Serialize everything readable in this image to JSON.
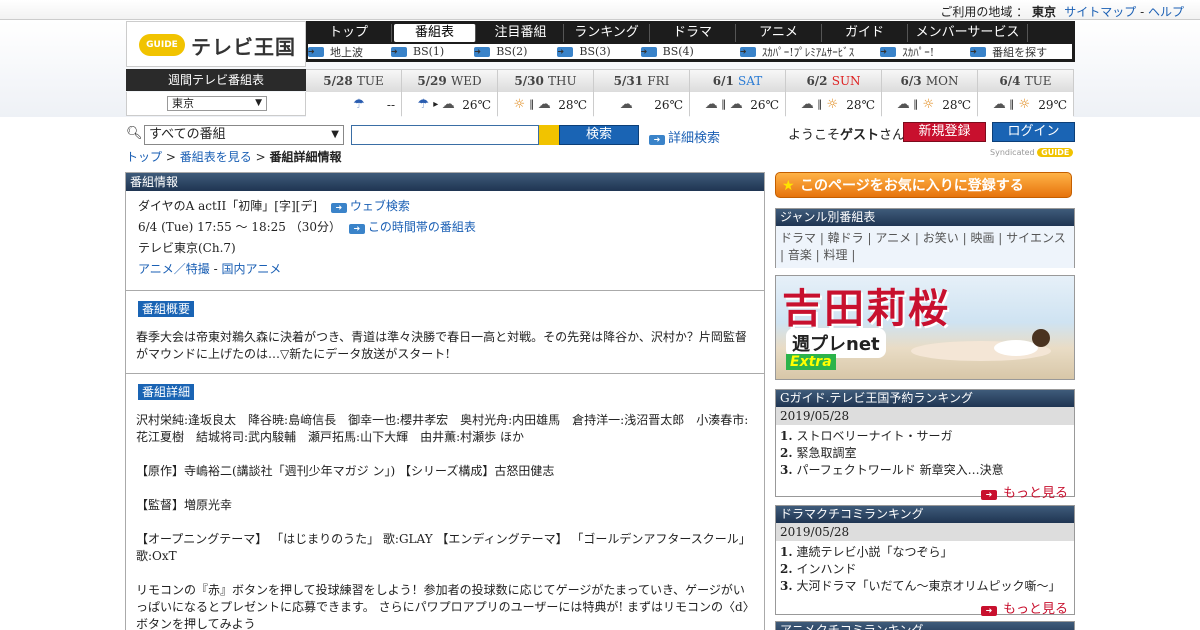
{
  "topbar": {
    "region_label": "ご利用の地域 ：",
    "region_value": "東京",
    "sitemap": "サイトマップ",
    "sep": "-",
    "help": "ヘルプ"
  },
  "logo": {
    "badge": "GUIDE",
    "title": "テレビ王国"
  },
  "nav": {
    "tabs": [
      "トップ",
      "番組表",
      "注目番組",
      "ランキング",
      "ドラマ",
      "アニメ",
      "ガイド",
      "メンバーサービス"
    ],
    "active_tab": "番組表",
    "sub": [
      "地上波",
      "BS(1)",
      "BS(2)",
      "BS(3)",
      "BS(4)",
      "ｽｶﾊﾟｰ!ﾌﾟﾚﾐｱﾑｻｰﾋﾞｽ",
      "ｽｶﾊﾟｰ!",
      "番組を探す"
    ]
  },
  "weekly": {
    "label": "週間テレビ番組表",
    "area": "東京",
    "days": [
      {
        "date": "5/28",
        "dow": "TUE",
        "dow_class": "",
        "weather": [
          "umb"
        ],
        "temp": "--"
      },
      {
        "date": "5/29",
        "dow": "WED",
        "dow_class": "",
        "weather": [
          "umb",
          "cloud"
        ],
        "temp": "26℃"
      },
      {
        "date": "5/30",
        "dow": "THU",
        "dow_class": "",
        "weather": [
          "sunny",
          "cloud"
        ],
        "temp": "28℃"
      },
      {
        "date": "5/31",
        "dow": "FRI",
        "dow_class": "",
        "weather": [
          "cloud"
        ],
        "temp": "26℃"
      },
      {
        "date": "6/1",
        "dow": "SAT",
        "dow_class": "sat",
        "weather": [
          "cloud",
          "cloud"
        ],
        "temp": "26℃"
      },
      {
        "date": "6/2",
        "dow": "SUN",
        "dow_class": "sun",
        "weather": [
          "cloud",
          "sunny"
        ],
        "temp": "28℃"
      },
      {
        "date": "6/3",
        "dow": "MON",
        "dow_class": "",
        "weather": [
          "cloud",
          "sunny"
        ],
        "temp": "28℃"
      },
      {
        "date": "6/4",
        "dow": "TUE",
        "dow_class": "",
        "weather": [
          "cloud",
          "sunny"
        ],
        "temp": "29℃"
      }
    ]
  },
  "search": {
    "select": "すべての番組",
    "button": "検索",
    "advanced": "詳細検索"
  },
  "user": {
    "welcome_pre": "ようこそ",
    "welcome_name": "ゲスト",
    "welcome_post": "さん",
    "register": "新規登録",
    "login": "ログイン"
  },
  "syndicated": {
    "text": "Syndicated",
    "badge": "GUIDE"
  },
  "breadcrumb": {
    "top": "トップ",
    "sep": ">",
    "schedule": "番組表を見る",
    "current": "番組詳細情報"
  },
  "program": {
    "header": "番組情報",
    "title": "ダイヤのA actII「初陣」[字][デ]",
    "web_search": "ウェブ検索",
    "time": "6/4 (Tue) 17:55 ～ 18:25 （30分）",
    "time_link": "この時間帯の番組表",
    "channel": "テレビ東京(Ch.7)",
    "genre_main": "アニメ／特撮",
    "genre_dash": "-",
    "genre_sub": "国内アニメ",
    "summary_label": "番組概要",
    "summary": "春季大会は帝東対鵜久森に決着がつき、青道は準々決勝で春日一高と対戦。その先発は降谷か、沢村か？片岡監督がマウンドに上げたのは…▽新たにデータ放送がスタート!",
    "detail_label": "番組詳細",
    "detail": [
      "沢村栄純:逢坂良太　降谷暁:島﨑信長　御幸一也:櫻井孝宏　奥村光舟:内田雄馬　倉持洋一:浅沼晋太郎　小湊春市:花江夏樹　結城将司:武内駿輔　瀬戸拓馬:山下大輝　由井薫:村瀬歩 ほか",
      "【原作】寺嶋裕二(講談社「週刊少年マガジ ン」) 【シリーズ構成】古怒田健志",
      "【監督】増原光幸",
      "【オープニングテーマ】 「はじまりのうた」 歌:GLAY 【エンディングテーマ】 「ゴールデンアフタースクール」 歌:OxT",
      "リモコンの『赤』ボタンを押して投球練習をしよう！参加者の投球数に応じてゲージがたまっていき、ゲージがいっぱいになるとプレゼントに応募できます。 さらにパワプロアプリのユーザーには特典が! まずはリモコンの〈d〉ボタンを押してみよう"
    ]
  },
  "sidebar": {
    "favorite": "このページをお気に入りに登録する",
    "genre_header": "ジャンル別番組表",
    "genre_text": "ドラマ | 韓ドラ | アニメ | お笑い | 映画 |  サイエンス | 音楽 | 料理 |",
    "ad": {
      "name": "吉田莉桜",
      "net": "週プレnet",
      "extra": "Extra"
    },
    "rank1": {
      "header": "Gガイド.テレビ王国予約ランキング",
      "date": "2019/05/28",
      "items": [
        {
          "n": "1.",
          "t": "ストロベリーナイト・サーガ"
        },
        {
          "n": "2.",
          "t": "緊急取調室"
        },
        {
          "n": "3.",
          "t": "パーフェクトワールド 新章突入…決意"
        }
      ],
      "more": "もっと見る"
    },
    "rank2": {
      "header": "ドラマクチコミランキング",
      "date": "2019/05/28",
      "items": [
        {
          "n": "1.",
          "t": "連続テレビ小説「なつぞら」"
        },
        {
          "n": "2.",
          "t": "インハンド"
        },
        {
          "n": "3.",
          "t": "大河ドラマ「いだてん～東京オリムピック噺～」"
        }
      ],
      "more": "もっと見る"
    },
    "rank3": {
      "header": "アニメクチコミランキング"
    }
  },
  "icons": {
    "arrow": "arrow-right-icon",
    "sunny": "sun-icon",
    "cloud": "cloud-icon",
    "umbrella": "umbrella-icon"
  }
}
